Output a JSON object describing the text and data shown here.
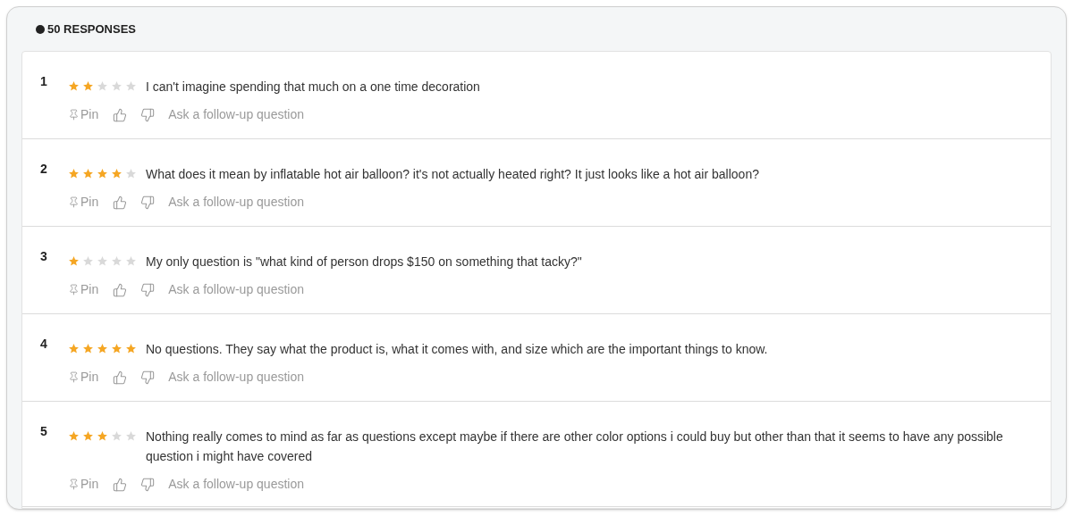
{
  "header": {
    "title": "50 RESPONSES"
  },
  "responses": [
    {
      "number": "1",
      "stars": 2,
      "text": "I can't imagine spending that much on a one time decoration",
      "pin": "Pin",
      "follow_up": "Ask a follow-up question"
    },
    {
      "number": "2",
      "stars": 4,
      "text": "What does it mean by inflatable hot air balloon? it's not actually heated right? It just looks like a hot air balloon?",
      "pin": "Pin",
      "follow_up": "Ask a follow-up question"
    },
    {
      "number": "3",
      "stars": 1,
      "text": "My only question is \"what kind of person drops $150 on something that tacky?\"",
      "pin": "Pin",
      "follow_up": "Ask a follow-up question"
    },
    {
      "number": "4",
      "stars": 5,
      "text": "No questions. They say what the product is, what it comes with, and size which are the important things to know.",
      "pin": "Pin",
      "follow_up": "Ask a follow-up question"
    },
    {
      "number": "5",
      "stars": 3,
      "text": "Nothing really comes to mind as far as questions except maybe if there are other color options i could buy but other than that it seems to have any possible question i might have covered",
      "pin": "Pin",
      "follow_up": "Ask a follow-up question"
    }
  ]
}
